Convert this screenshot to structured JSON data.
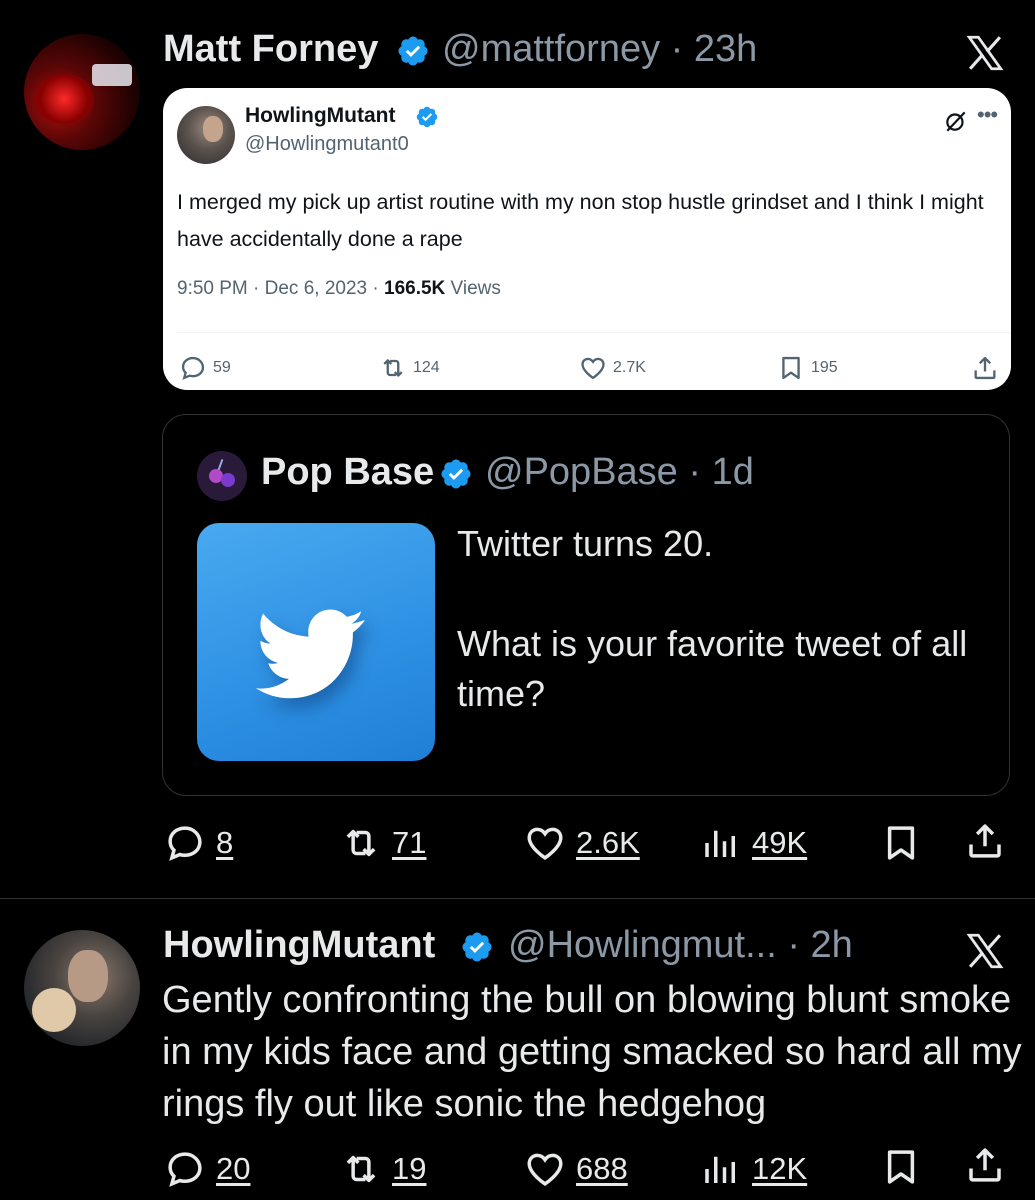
{
  "tweet1": {
    "author_name": "Matt Forney",
    "handle_time": "@mattforney · 23h",
    "embedded": {
      "author_name": "HowlingMutant",
      "handle": "@Howlingmutant0",
      "text": "I merged my pick up artist routine with my non stop hustle grindset and I think I might have accidentally done a rape",
      "time_date": "9:50 PM · Dec 6, 2023 · ",
      "views_count": "166.5K",
      "views_label": " Views",
      "replies": "59",
      "retweets": "124",
      "likes": "2.7K",
      "bookmarks": "195"
    },
    "quote": {
      "author_name": "Pop Base",
      "handle_time": "@PopBase · 1d",
      "text": "Twitter turns 20.\n\nWhat is your favorite tweet of all time?"
    },
    "actions": {
      "replies": "8",
      "retweets": "71",
      "likes": "2.6K",
      "views": "49K"
    }
  },
  "tweet2": {
    "author_name": "HowlingMutant",
    "handle_time": "@Howlingmut... · 2h",
    "text": "Gently confronting the bull on blowing blunt smoke in my kids face and getting smacked so hard all my rings fly out like sonic the hedgehog",
    "actions": {
      "replies": "20",
      "retweets": "19",
      "likes": "688",
      "views": "12K"
    }
  },
  "colors": {
    "background": "#000000",
    "text": "#e7e9ea",
    "secondary": "#8b98a5",
    "verified": "#1d9bf0",
    "border": "#2f3336"
  },
  "icons": [
    "verified-badge-icon",
    "x-logo-icon",
    "reply-icon",
    "retweet-icon",
    "like-icon",
    "views-icon",
    "bookmark-icon",
    "share-icon",
    "grok-icon",
    "more-icon",
    "twitter-bird-icon"
  ]
}
